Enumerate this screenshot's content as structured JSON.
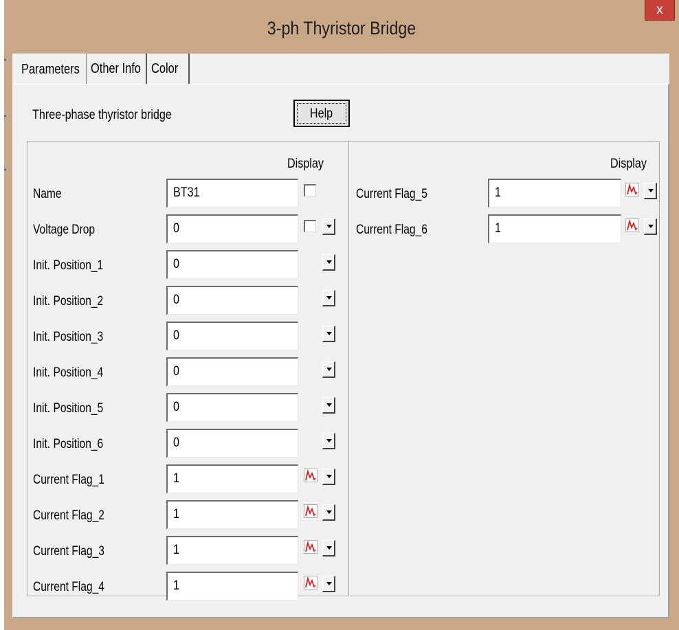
{
  "window": {
    "title": "3-ph Thyristor Bridge",
    "close_label": "x"
  },
  "tabs": [
    {
      "label": "Parameters",
      "active": true
    },
    {
      "label": "Other Info",
      "active": false
    },
    {
      "label": "Color",
      "active": false
    }
  ],
  "page": {
    "description": "Three-phase thyristor bridge",
    "help_label": "Help",
    "display_header_left": "Display",
    "display_header_right": "Display"
  },
  "left_params": [
    {
      "label": "Name",
      "value": "BT31",
      "display": "checkbox",
      "dropdown": false
    },
    {
      "label": "Voltage Drop",
      "value": "0",
      "display": "checkbox",
      "dropdown": true
    },
    {
      "label": "Init. Position_1",
      "value": "0",
      "display": "none",
      "dropdown": true
    },
    {
      "label": "Init. Position_2",
      "value": "0",
      "display": "none",
      "dropdown": true
    },
    {
      "label": "Init. Position_3",
      "value": "0",
      "display": "none",
      "dropdown": true
    },
    {
      "label": "Init. Position_4",
      "value": "0",
      "display": "none",
      "dropdown": true
    },
    {
      "label": "Init. Position_5",
      "value": "0",
      "display": "none",
      "dropdown": true
    },
    {
      "label": "Init. Position_6",
      "value": "0",
      "display": "none",
      "dropdown": true
    },
    {
      "label": "Current Flag_1",
      "value": "1",
      "display": "waveform-icon",
      "dropdown": true
    },
    {
      "label": "Current Flag_2",
      "value": "1",
      "display": "waveform-icon",
      "dropdown": true
    },
    {
      "label": "Current Flag_3",
      "value": "1",
      "display": "waveform-icon",
      "dropdown": true
    },
    {
      "label": "Current Flag_4",
      "value": "1",
      "display": "waveform-icon",
      "dropdown": true
    }
  ],
  "right_params": [
    {
      "label": "Current Flag_5",
      "value": "1",
      "display": "waveform-icon",
      "dropdown": true
    },
    {
      "label": "Current Flag_6",
      "value": "1",
      "display": "waveform-icon",
      "dropdown": true
    }
  ],
  "colors": {
    "titlebar": "#c9a888",
    "close": "#c7403a",
    "face": "#f0f0f0",
    "waveform": "#e0201c"
  }
}
